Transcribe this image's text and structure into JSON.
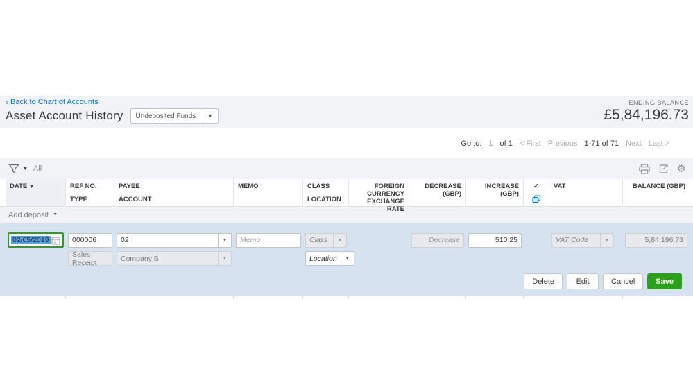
{
  "header": {
    "back_link": "Back to Chart of Accounts",
    "back_chevron": "‹",
    "title": "Asset Account History",
    "account_select_value": "Undeposited Funds",
    "ending_balance_label": "ENDING BALANCE",
    "ending_balance_value": "£5,84,196.73"
  },
  "pagination": {
    "go_to_label": "Go to:",
    "page_value": "1",
    "of_label": "of 1",
    "first": "< First",
    "previous": "Previous",
    "range": "1-71 of 71",
    "next": "Next",
    "last": "Last >"
  },
  "filter": {
    "all_label": "All"
  },
  "table": {
    "columns": [
      {
        "line1": "DATE",
        "line2": ""
      },
      {
        "line1": "REF NO.",
        "line2": "TYPE"
      },
      {
        "line1": "PAYEE",
        "line2": "ACCOUNT"
      },
      {
        "line1": "MEMO",
        "line2": ""
      },
      {
        "line1": "CLASS",
        "line2": "LOCATION"
      },
      {
        "line1": "FOREIGN CURRENCY",
        "line2": "EXCHANGE RATE"
      },
      {
        "line1": "DECREASE (GBP)",
        "line2": ""
      },
      {
        "line1": "INCREASE (GBP)",
        "line2": ""
      },
      {
        "line1": "✓",
        "line2": ""
      },
      {
        "line1": "VAT",
        "line2": ""
      },
      {
        "line1": "BALANCE (GBP)",
        "line2": ""
      }
    ],
    "add_row_label": "Add deposit"
  },
  "edit_row": {
    "date": "02/05/2019",
    "ref_no": "000006",
    "payee": "02",
    "type": "Sales Receipt",
    "account": "Company B",
    "memo_placeholder": "Memo",
    "class_placeholder": "Class",
    "location_placeholder": "Location",
    "decrease_placeholder": "Decrease",
    "increase": "510.25",
    "vat_placeholder": "VAT Code",
    "balance": "5,84,196.73"
  },
  "actions": {
    "delete": "Delete",
    "edit": "Edit",
    "cancel": "Cancel",
    "save": "Save"
  },
  "icons": {
    "dropdown_arrow": "▼",
    "sort_arrow": "▼",
    "check": "✓"
  },
  "colors": {
    "link_blue": "#0077c5",
    "save_green": "#2ca01c",
    "edit_band_blue": "#d6e2ef",
    "band_gray": "#f2f3f7"
  }
}
